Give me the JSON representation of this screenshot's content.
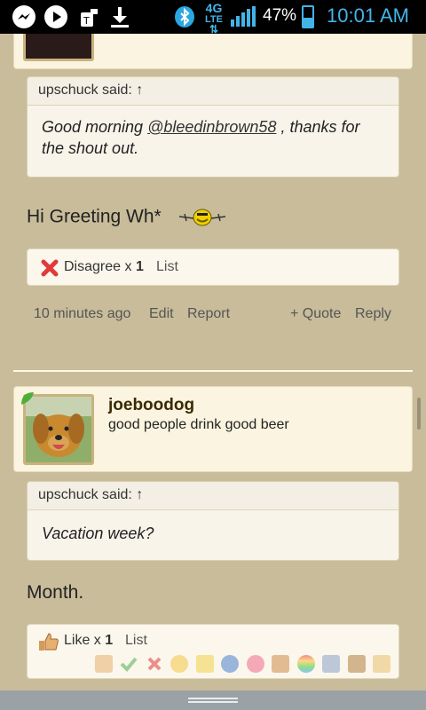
{
  "status_bar": {
    "network_badge": "4G LTE",
    "battery_percent_text": "47%",
    "battery_level": 0.47,
    "time": "10:01 AM",
    "icons": [
      "messenger-icon",
      "play-icon",
      "tool-icon",
      "download-icon",
      "bluetooth-icon",
      "signal-icon",
      "battery-icon"
    ],
    "accent_color": "#43b4e8"
  },
  "post1": {
    "quote": {
      "author_line": "upschuck said:",
      "up_arrow": "↑",
      "text_prefix": "Good morning ",
      "mention": "@bleedinbrown58",
      "text_suffix": " , thanks for the shout out."
    },
    "message": "Hi Greeting Wh*",
    "reactions": {
      "label": "Disagree x",
      "count": "1",
      "list_label": "List"
    },
    "actions": {
      "time": "10 minutes ago",
      "edit": "Edit",
      "report": "Report",
      "quote": "+ Quote",
      "reply": "Reply"
    }
  },
  "post2": {
    "username": "joeboodog",
    "user_title": "good people drink good beer",
    "quote": {
      "author_line": "upschuck said:",
      "up_arrow": "↑",
      "text": "Vacation week?"
    },
    "message": "Month.",
    "reactions": {
      "label": "Like x",
      "count": "1",
      "list_label": "List"
    }
  },
  "colors": {
    "page_bg": "#c8bc9a",
    "card_bg": "#fbf4e0",
    "status_bar_bg": "#000000"
  }
}
